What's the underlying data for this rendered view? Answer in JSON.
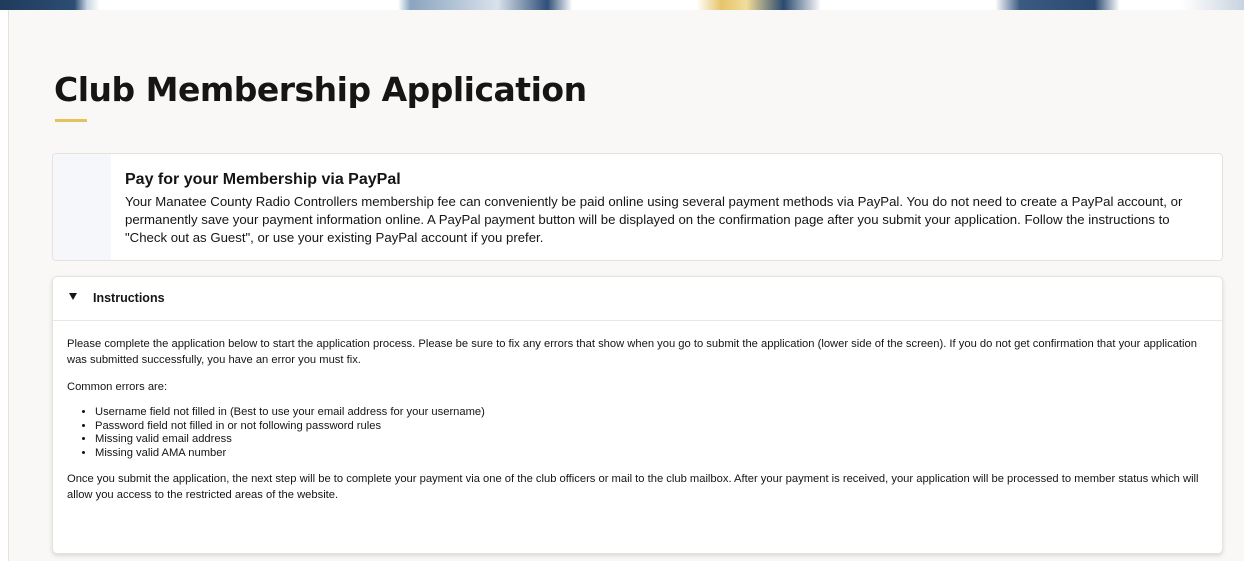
{
  "page": {
    "title": "Club Membership Application",
    "accent_color": "#e4c35b"
  },
  "paypal": {
    "title": "Pay for your Membership via PayPal",
    "body": "Your Manatee County Radio Controllers membership fee can conveniently be paid online using several payment methods via PayPal. You do not need to create a PayPal account, or permanently save your payment information online. A PayPal payment button will be displayed on the confirmation page after you submit your application. Follow the instructions to \"Check out as Guest\", or use your existing PayPal account if you prefer."
  },
  "instructions": {
    "label": "Instructions",
    "expanded": true,
    "intro": "Please complete the application below to start the application process.  Please be sure to fix any errors that show when you go to submit the application (lower side of the screen).  If you do not get confirmation that your application was submitted successfully, you have an error you must fix.",
    "common_errors_label": "Common errors are:",
    "errors": [
      "Username field not filled in (Best to use your email address for your username)",
      "Password field not filled in or not following password rules",
      "Missing valid email address",
      "Missing valid AMA number"
    ],
    "outro": "Once you submit the application, the next step will be to complete your payment via one of the club officers or mail to the club mailbox.  After your payment is received, your application will be processed to member status which will allow you access to the restricted areas of the website."
  }
}
